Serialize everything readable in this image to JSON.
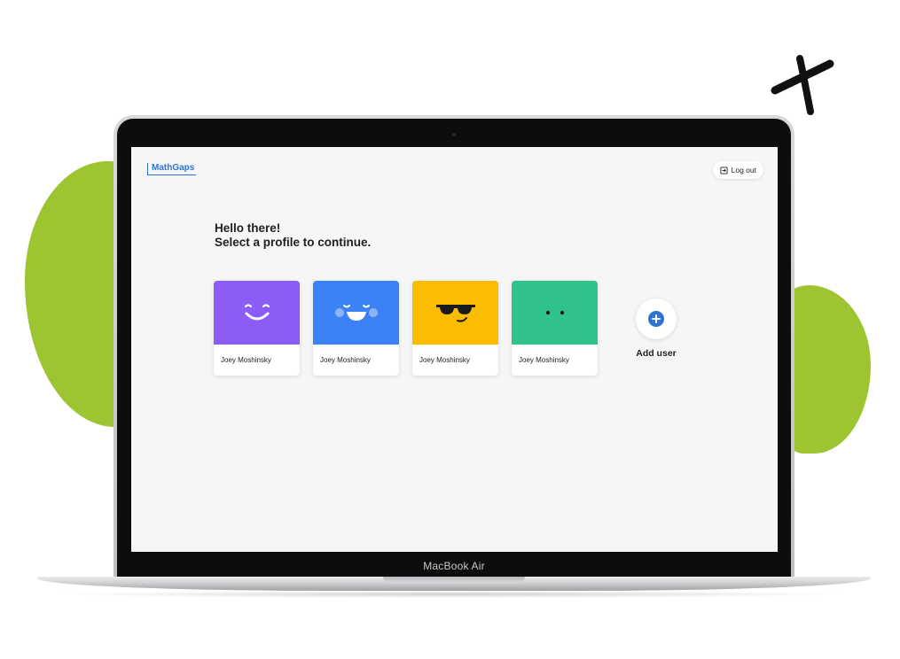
{
  "app": {
    "logo": "MathGaps",
    "logout_label": "Log out"
  },
  "greeting": {
    "line1": "Hello there!",
    "line2": "Select a profile to continue."
  },
  "profiles": [
    {
      "name": "Joey Moshinsky",
      "color": "#8b5cf6",
      "face": "happy-face-icon"
    },
    {
      "name": "Joey Moshinsky",
      "color": "#3b82f6",
      "face": "blushing-face-icon"
    },
    {
      "name": "Joey Moshinsky",
      "color": "#f9bc00",
      "face": "sunglasses-face-icon"
    },
    {
      "name": "Joey Moshinsky",
      "color": "#2fc28a",
      "face": "neutral-face-icon"
    }
  ],
  "add_user": {
    "label": "Add user",
    "icon": "plus-circle-icon"
  },
  "device": {
    "label": "MacBook Air"
  },
  "colors": {
    "accent": "#2f73d9",
    "blob": "#9dc431"
  }
}
